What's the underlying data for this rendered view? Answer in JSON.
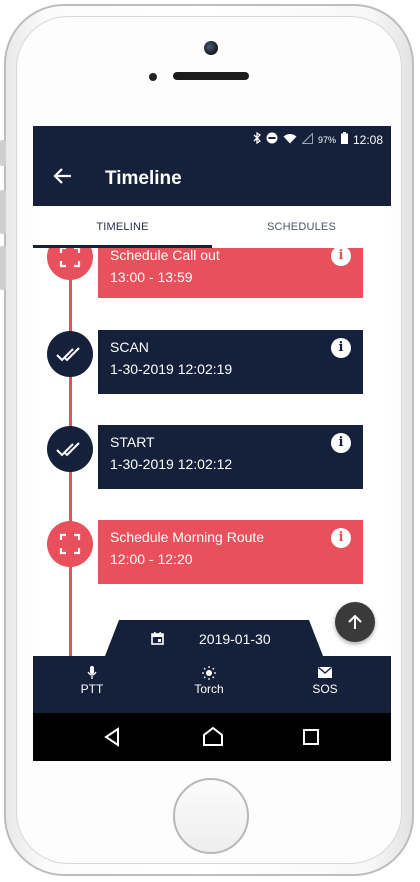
{
  "status": {
    "battery": "97%",
    "time": "12:08",
    "icons": [
      "bluetooth-icon",
      "dnd-icon",
      "wifi-icon",
      "signal-icon",
      "battery-icon"
    ]
  },
  "appbar": {
    "title": "Timeline",
    "back_icon": "arrow-left-icon"
  },
  "tabs": [
    {
      "label": "TIMELINE",
      "active": true
    },
    {
      "label": "SCHEDULES",
      "active": false
    }
  ],
  "timeline": [
    {
      "kind": "schedule",
      "title": "Schedule Call out",
      "time": "13:00 - 13:59",
      "color": "#e8505b"
    },
    {
      "kind": "scan",
      "title": "SCAN",
      "time": "1-30-2019 12:02:19",
      "color": "#15203a"
    },
    {
      "kind": "scan",
      "title": "START",
      "time": "1-30-2019 12:02:12",
      "color": "#15203a"
    },
    {
      "kind": "schedule",
      "title": "Schedule Morning Route",
      "time": "12:00 - 12:20",
      "color": "#e8505b"
    }
  ],
  "info_icon": "i",
  "date": {
    "value": "2019-01-30",
    "icon": "calendar-icon"
  },
  "scroll_top_icon": "arrow-up-icon",
  "bottom_nav": [
    {
      "label": "PTT",
      "icon": "microphone-icon"
    },
    {
      "label": "Torch",
      "icon": "sun-icon"
    },
    {
      "label": "SOS",
      "icon": "mail-icon"
    }
  ],
  "colors": {
    "navy": "#15203a",
    "accent": "#e8505b"
  }
}
